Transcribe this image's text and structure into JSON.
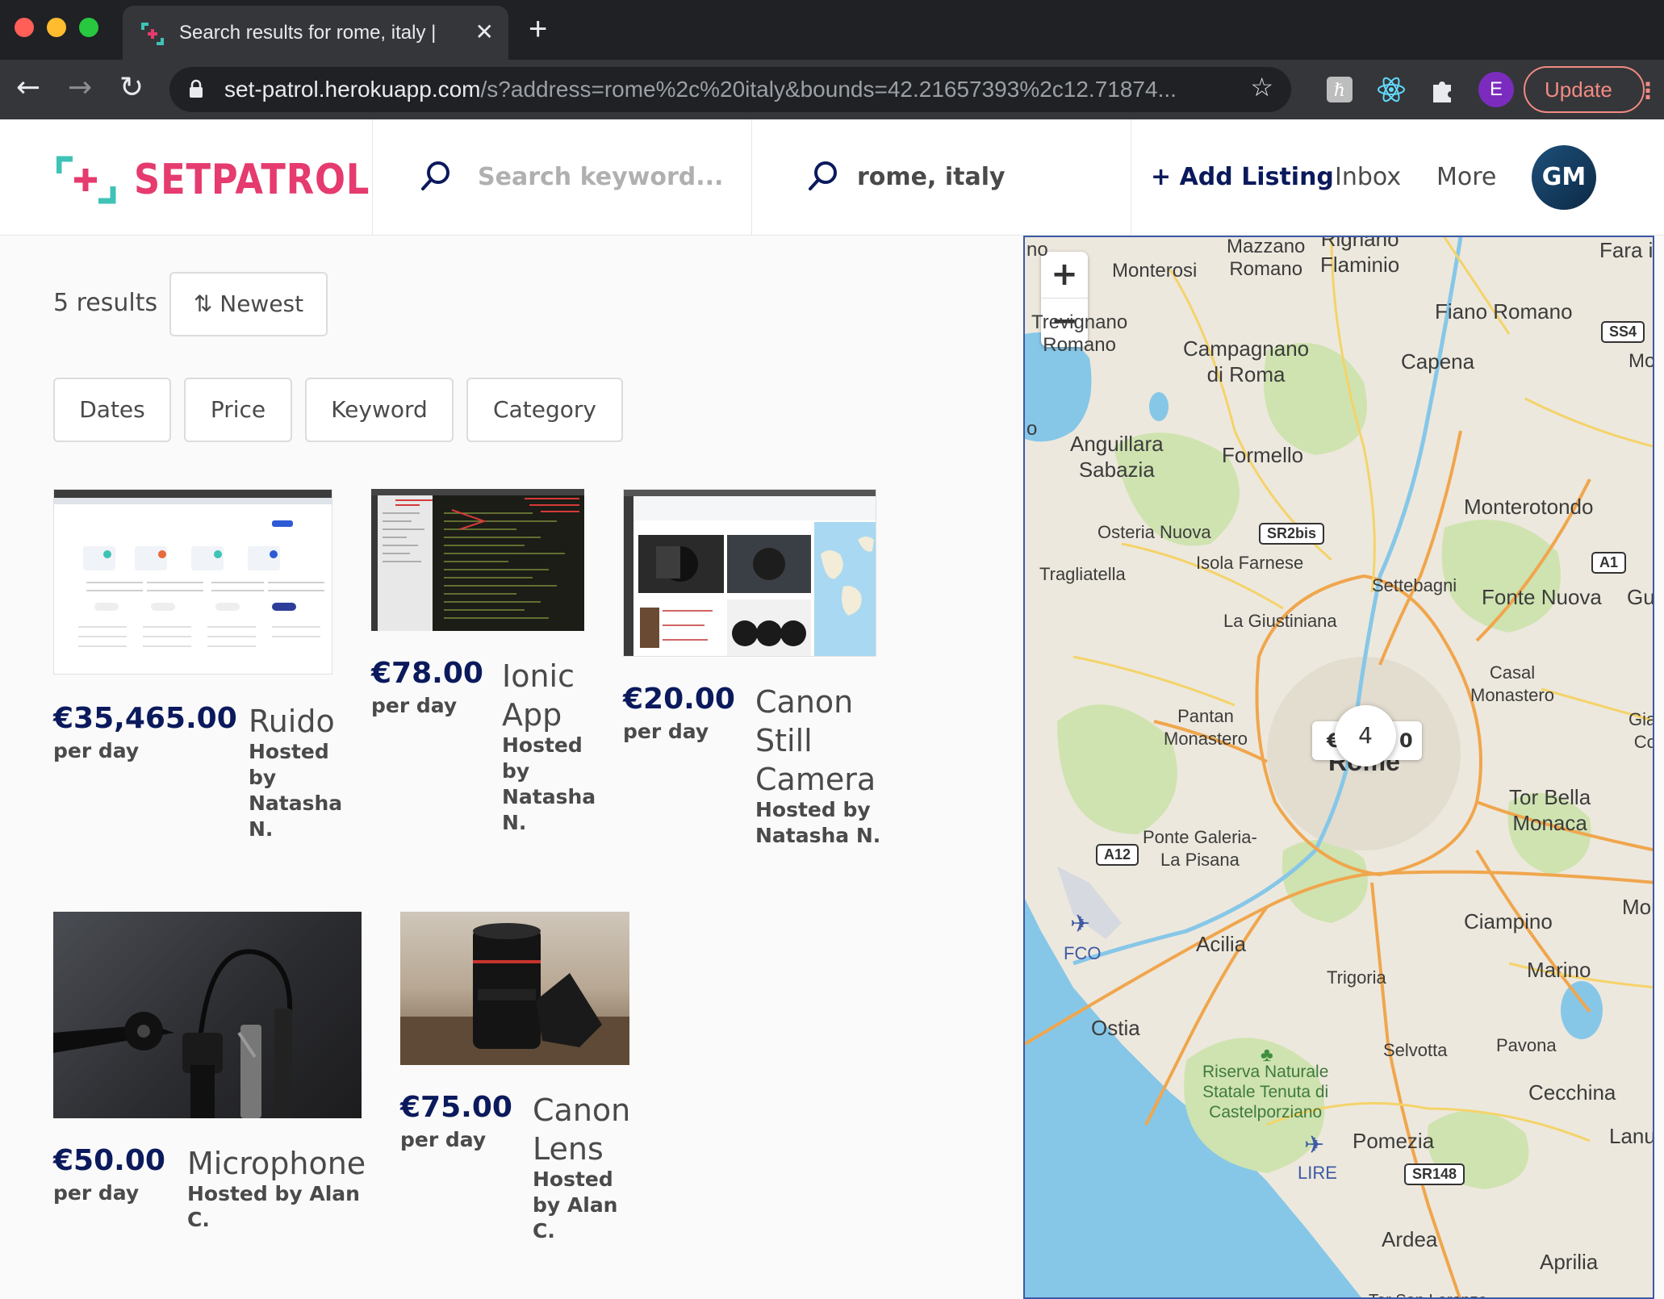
{
  "browser": {
    "tab_title": "Search results for rome, italy | ",
    "url_host": "set-patrol.herokuapp.com",
    "url_path": "/s?address=rome%2c%20italy&bounds=42.21657393%2c12.71874...",
    "extension_avatar": "E",
    "update_label": "Update"
  },
  "header": {
    "logo_text": "SETPATROL",
    "search_placeholder": "Search keyword...",
    "location_value": "rome, italy",
    "add_listing": "+ Add Listing",
    "inbox": "Inbox",
    "more": "More",
    "avatar_initials": "GM"
  },
  "results": {
    "count_label": "5 results",
    "sort_label": "Newest",
    "filters": [
      "Dates",
      "Price",
      "Keyword",
      "Category"
    ]
  },
  "listings": [
    {
      "price": "€35,465.00",
      "per": "per day",
      "title": "Ruido",
      "host": [
        "Hosted",
        "by",
        "Natasha",
        "N."
      ]
    },
    {
      "price": "€78.00",
      "per": "per day",
      "title": "Ionic App",
      "host": [
        "Hosted",
        "by",
        "Natasha",
        "N."
      ]
    },
    {
      "price": "€20.00",
      "per": "per day",
      "title": "Canon Still Camera",
      "host": [
        "Hosted by",
        "Natasha N."
      ]
    },
    {
      "price": "€50.00",
      "per": "per day",
      "title": "Microphone",
      "host": [
        "Hosted by Alan C."
      ]
    },
    {
      "price": "€75.00",
      "per": "per day",
      "title": "Canon Lens",
      "host": [
        "Hosted",
        "by Alan C."
      ]
    }
  ],
  "map": {
    "cluster_count": "4",
    "pin_price_start": "€",
    "pin_price_end": "0",
    "places": {
      "mazzano": "Mazzano\nRomano",
      "flaminio": "Rignano\nFlaminio",
      "fara": "Fara i",
      "monterosi": "Monterosi",
      "fiano": "Fiano Romano",
      "trevignano": "Trevignano\nRomano",
      "campagnano": "Campagnano\ndi Roma",
      "capena": "Capena",
      "mor": "Mor",
      "anguillara": "Anguillara\nSabazia",
      "formello": "Formello",
      "osteria": "Osteria Nuova",
      "monterotondo": "Monterotondo",
      "tragliatella": "Tragliatella",
      "isola": "Isola Farnese",
      "settebagni": "Settebagni",
      "fonte": "Fonte Nuova",
      "gui": "Gui",
      "giustiniana": "La Giustiniana",
      "casal": "Casal\nMonastero",
      "gia": "Giar\nCo",
      "pantan": "Pantan\nMonastero",
      "rome": "Rome",
      "torbella": "Tor Bella\nMonaca",
      "galeria": "Ponte Galeria-\nLa Pisana",
      "monte": "Monte",
      "ciampino": "Ciampino",
      "fco": "FCO",
      "acilia": "Acilia",
      "marino": "Marino",
      "trigoria": "Trigoria",
      "ostia": "Ostia",
      "selvotta": "Selvotta",
      "pavona": "Pavona",
      "riserva": "Riserva Naturale\nStatale Tenuta di\nCastelporziano",
      "cecchina": "Cecchina",
      "pomezia": "Pomezia",
      "lanuvi": "Lanuvi",
      "lire": "LIRE",
      "ardea": "Ardea",
      "aprilia": "Aprilia",
      "torsanl": "Tor San Lorenzo",
      "no": "no",
      "o": "o"
    },
    "shields": {
      "ss4": "SS4",
      "sr2bis": "SR2bis",
      "a1": "A1",
      "a12": "A12",
      "sr148": "SR148"
    }
  },
  "colors": {
    "brand_pink": "#e53b6e",
    "brand_teal": "#3ec3b6",
    "primary_navy": "#0b1a5c",
    "map_border": "#3d5aa5"
  }
}
